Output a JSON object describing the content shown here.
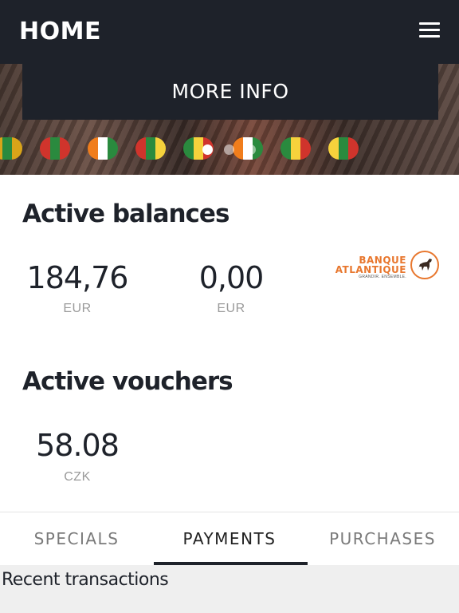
{
  "header": {
    "title": "HOME"
  },
  "banner": {
    "more_info_label": "MORE INFO",
    "flags": [
      [
        "#d9a419",
        "#2a8a3e",
        "#d9a419"
      ],
      [
        "#d0342c",
        "#2a8a3e",
        "#d0342c"
      ],
      [
        "#f07d1c",
        "#ffffff",
        "#2a8a3e"
      ],
      [
        "#d0342c",
        "#2a8a3e",
        "#f6d23c"
      ],
      [
        "#2a8a3e",
        "#f6d23c",
        "#d0342c"
      ],
      [
        "#f07d1c",
        "#ffffff",
        "#2a8a3e"
      ],
      [
        "#2a8a3e",
        "#f6d23c",
        "#d0342c"
      ],
      [
        "#f6d23c",
        "#2a8a3e",
        "#d0342c"
      ]
    ]
  },
  "balances": {
    "heading": "Active balances",
    "items": [
      {
        "amount": "184,76",
        "currency": "EUR"
      },
      {
        "amount": "0,00",
        "currency": "EUR"
      }
    ],
    "logo": {
      "line1": "BANQUE",
      "line2": "ATLANTIQUE",
      "tagline": "GRANDIR. ENSEMBLE."
    }
  },
  "vouchers": {
    "heading": "Active vouchers",
    "items": [
      {
        "amount": "58.08",
        "currency": "CZK"
      }
    ]
  },
  "tabs": [
    {
      "label": "SPECIALS",
      "active": false
    },
    {
      "label": "PAYMENTS",
      "active": true
    },
    {
      "label": "PURCHASES",
      "active": false
    }
  ],
  "recent": {
    "label": "Recent transactions"
  },
  "colors": {
    "dark": "#1e222a",
    "accent": "#e8772e"
  }
}
